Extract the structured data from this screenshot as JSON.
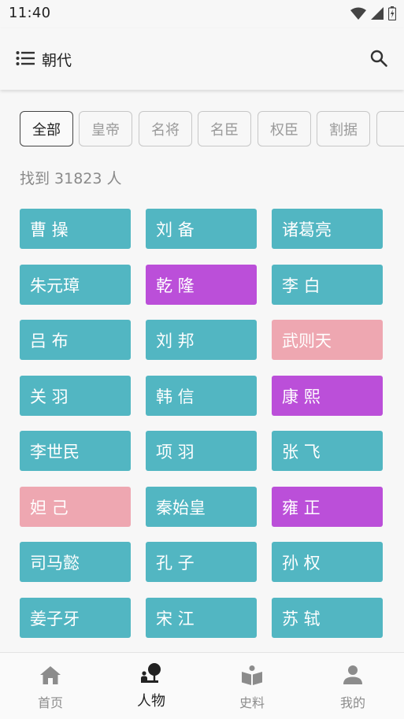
{
  "status_bar": {
    "time": "11:40"
  },
  "app_bar": {
    "title": "朝代"
  },
  "filters": [
    {
      "label": "全部",
      "active": true
    },
    {
      "label": "皇帝",
      "active": false
    },
    {
      "label": "名将",
      "active": false
    },
    {
      "label": "名臣",
      "active": false
    },
    {
      "label": "权臣",
      "active": false
    },
    {
      "label": "割据",
      "active": false
    },
    {
      "label": "",
      "active": false
    }
  ],
  "result_count": "找到 31823 人",
  "people": [
    {
      "name": "曹 操",
      "color": "teal"
    },
    {
      "name": "刘 备",
      "color": "teal"
    },
    {
      "name": "诸葛亮",
      "color": "teal"
    },
    {
      "name": "朱元璋",
      "color": "teal"
    },
    {
      "name": "乾 隆",
      "color": "purple"
    },
    {
      "name": "李 白",
      "color": "teal"
    },
    {
      "name": "吕 布",
      "color": "teal"
    },
    {
      "name": "刘 邦",
      "color": "teal"
    },
    {
      "name": "武则天",
      "color": "pink"
    },
    {
      "name": "关 羽",
      "color": "teal"
    },
    {
      "name": "韩 信",
      "color": "teal"
    },
    {
      "name": "康 熙",
      "color": "purple"
    },
    {
      "name": "李世民",
      "color": "teal"
    },
    {
      "name": "项 羽",
      "color": "teal"
    },
    {
      "name": "张 飞",
      "color": "teal"
    },
    {
      "name": "妲 己",
      "color": "pink"
    },
    {
      "name": "秦始皇",
      "color": "teal"
    },
    {
      "name": "雍 正",
      "color": "purple"
    },
    {
      "name": "司马懿",
      "color": "teal"
    },
    {
      "name": "孔 子",
      "color": "teal"
    },
    {
      "name": "孙 权",
      "color": "teal"
    },
    {
      "name": "姜子牙",
      "color": "teal"
    },
    {
      "name": "宋 江",
      "color": "teal"
    },
    {
      "name": "苏 轼",
      "color": "teal"
    }
  ],
  "colors": {
    "teal": "#52b6c2",
    "purple": "#bb4fd9",
    "pink": "#eea7b1"
  },
  "bottom_nav": [
    {
      "label": "首页",
      "icon": "home-icon",
      "active": false
    },
    {
      "label": "人物",
      "icon": "person-tree-icon",
      "active": true
    },
    {
      "label": "史料",
      "icon": "book-icon",
      "active": false
    },
    {
      "label": "我的",
      "icon": "profile-icon",
      "active": false
    }
  ]
}
